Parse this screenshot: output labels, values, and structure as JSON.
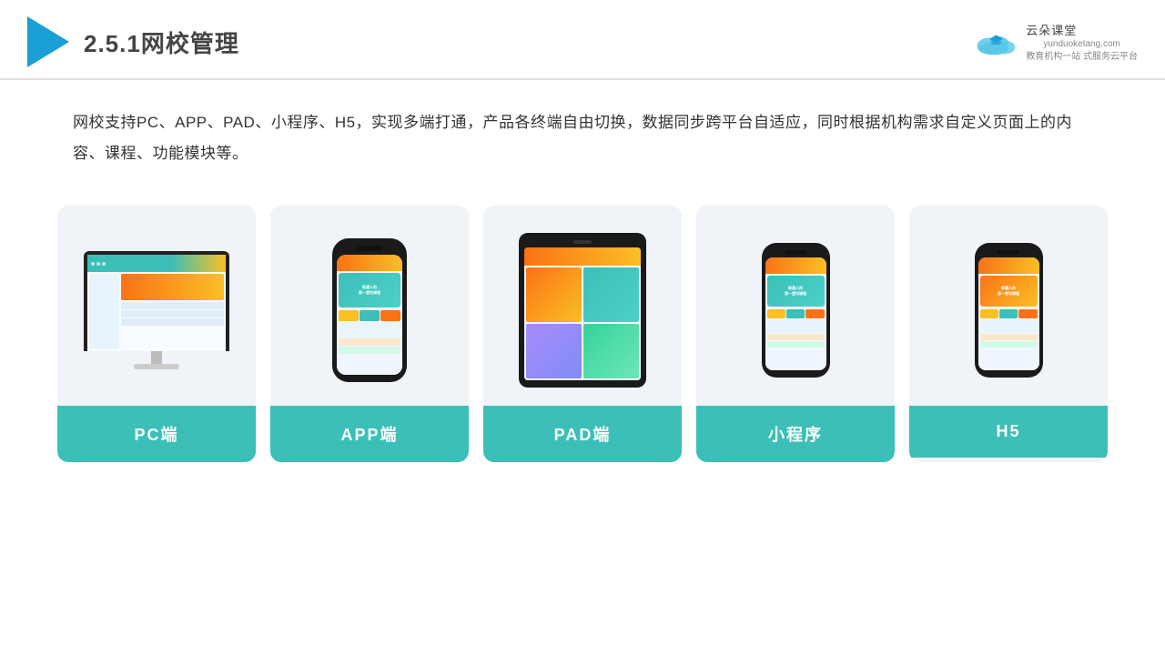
{
  "header": {
    "title_prefix": "2.5.1",
    "title_main": "网校管理",
    "brand_name": "云朵课堂",
    "brand_url": "yunduoketang.com",
    "brand_tagline": "教育机构一站\n式服务云平台"
  },
  "description": {
    "text": "网校支持PC、APP、PAD、小程序、H5，实现多端打通，产品各终端自由切换，数据同步跨平台自适应，同时根据机构需求自定义页面上的内容、课程、功能模块等。"
  },
  "cards": [
    {
      "id": "pc",
      "label": "PC端"
    },
    {
      "id": "app",
      "label": "APP端"
    },
    {
      "id": "pad",
      "label": "PAD端"
    },
    {
      "id": "miniprogram",
      "label": "小程序"
    },
    {
      "id": "h5",
      "label": "H5"
    }
  ],
  "colors": {
    "teal": "#3bbfb8",
    "accent": "#1a9fd4",
    "bg_card": "#f0f4f8"
  }
}
